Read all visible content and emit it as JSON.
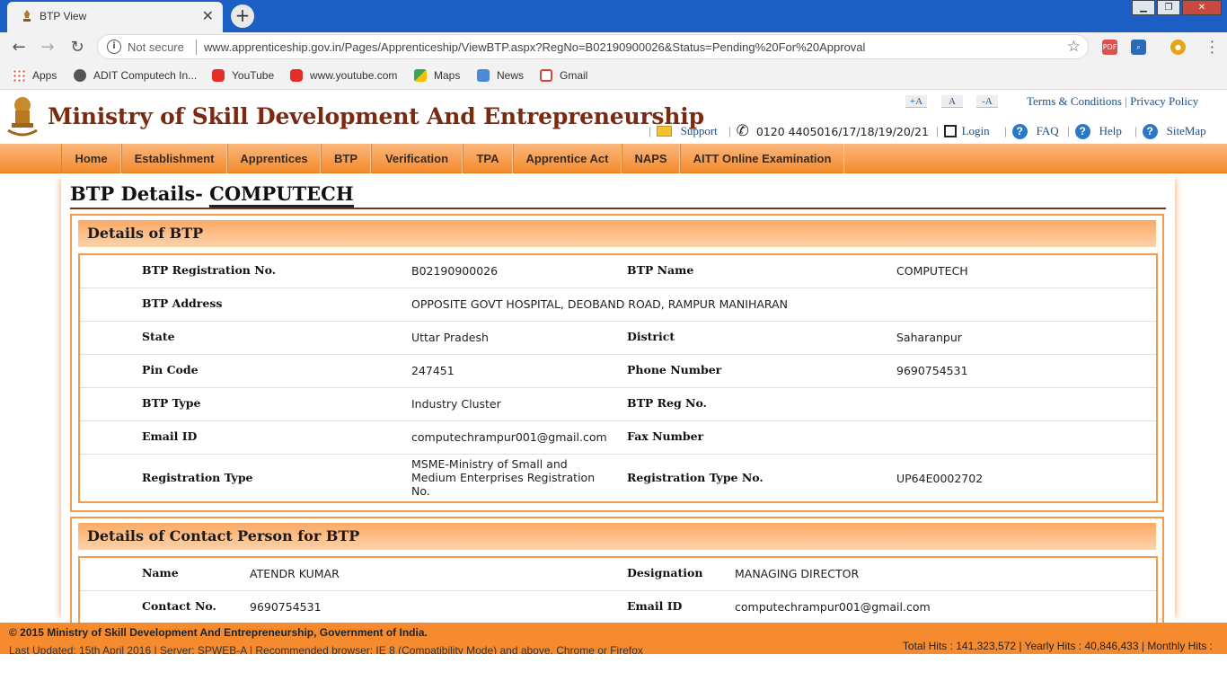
{
  "browser": {
    "tab_title": "BTP View",
    "tab_close": "✕",
    "new_tab": "+",
    "security_label": "Not secure",
    "url": "www.apprenticeship.gov.in/Pages/Apprenticeship/ViewBTP.aspx?RegNo=B02190900026&Status=Pending%20For%20Approval",
    "bookmarks": [
      "Apps",
      "ADIT Computech In...",
      "YouTube",
      "www.youtube.com",
      "Maps",
      "News",
      "Gmail"
    ]
  },
  "header": {
    "title": "Ministry of Skill Development And Entrepreneurship",
    "font_controls": [
      "+A",
      "A",
      "-A"
    ],
    "top_links": [
      "Terms & Conditions",
      "Privacy Policy"
    ],
    "support": "Support",
    "phone": "0120 4405016/17/18/19/20/21",
    "login": "Login",
    "faq": "FAQ",
    "help": "Help",
    "sitemap": "SiteMap"
  },
  "nav": [
    "Home",
    "Establishment",
    "Apprentices",
    "BTP",
    "Verification",
    "TPA",
    "Apprentice Act",
    "NAPS",
    "AITT Online Examination"
  ],
  "page": {
    "title_prefix": "BTP Details-",
    "title_name": "COMPUTECH"
  },
  "btp_details": {
    "heading": "Details of BTP",
    "rows": [
      {
        "l1": "BTP Registration No.",
        "v1": "B02190900026",
        "l2": "BTP Name",
        "v2": "COMPUTECH"
      },
      {
        "l1": "BTP Address",
        "v1": "OPPOSITE GOVT HOSPITAL, DEOBAND ROAD, RAMPUR MANIHARAN",
        "l2": "",
        "v2": ""
      },
      {
        "l1": "State",
        "v1": "Uttar Pradesh",
        "l2": "District",
        "v2": "Saharanpur"
      },
      {
        "l1": "Pin Code",
        "v1": "247451",
        "l2": "Phone Number",
        "v2": "9690754531"
      },
      {
        "l1": "BTP Type",
        "v1": "Industry Cluster",
        "l2": "BTP Reg No.",
        "v2": ""
      },
      {
        "l1": "Email ID",
        "v1": "computechrampur001@gmail.com",
        "l2": "Fax Number",
        "v2": ""
      },
      {
        "l1": "Registration Type",
        "v1": "MSME-Ministry of Small and Medium Enterprises Registration No.",
        "l2": "Registration Type No.",
        "v2": "UP64E0002702"
      }
    ]
  },
  "contact_details": {
    "heading": "Details of Contact Person for BTP",
    "rows": [
      {
        "l1": "Name",
        "v1": "ATENDR KUMAR",
        "l2": "Designation",
        "v2": "MANAGING DIRECTOR"
      },
      {
        "l1": "Contact No.",
        "v1": "9690754531",
        "l2": "Email ID",
        "v2": "computechrampur001@gmail.com"
      }
    ]
  },
  "footer": {
    "copyright": "© 2015 Ministry of Skill Development And Entrepreneurship, Government of India.",
    "updated": "Last Updated: 15th April 2016 | Server: SPWEB-A | Recommended browser: IE 8 (Compatibility Mode) and above, Chrome or Firefox",
    "hits": "Total Hits : 141,323,572 | Yearly Hits : 40,846,433 | Monthly Hits :"
  }
}
